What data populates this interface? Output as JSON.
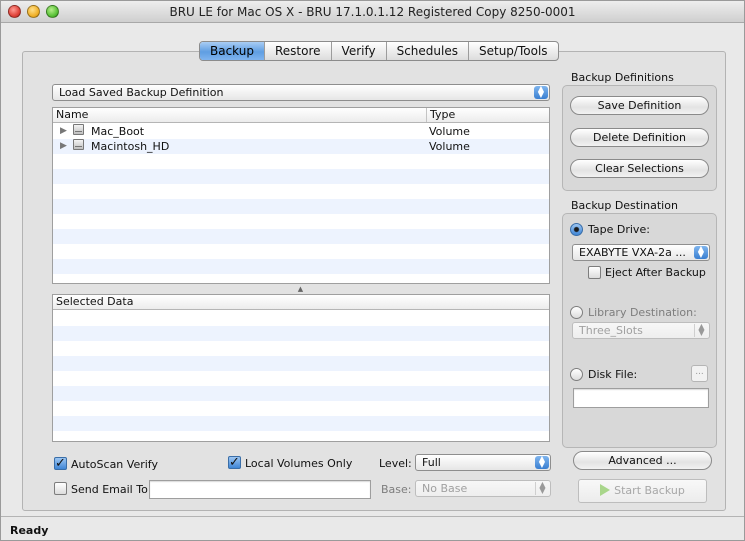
{
  "window": {
    "title": "BRU LE for Mac OS X - BRU 17.1.0.1.12 Registered Copy 8250-0001"
  },
  "tabs": [
    {
      "label": "Backup",
      "active": true
    },
    {
      "label": "Restore",
      "active": false
    },
    {
      "label": "Verify",
      "active": false
    },
    {
      "label": "Schedules",
      "active": false
    },
    {
      "label": "Setup/Tools",
      "active": false
    }
  ],
  "definition_popup": {
    "value": "Load Saved Backup Definition"
  },
  "source_table": {
    "headers": {
      "name": "Name",
      "type": "Type"
    },
    "rows": [
      {
        "name": "Mac_Boot",
        "type": "Volume"
      },
      {
        "name": "Macintosh_HD",
        "type": "Volume"
      }
    ]
  },
  "selected_table": {
    "header": "Selected Data"
  },
  "backup_definitions": {
    "title": "Backup Definitions",
    "save_label": "Save Definition",
    "delete_label": "Delete Definition",
    "clear_label": "Clear Selections"
  },
  "backup_destination": {
    "title": "Backup Destination",
    "tape_drive_label": "Tape Drive:",
    "tape_drive_selected": true,
    "tape_drive_value": "EXABYTE VXA-2a ...",
    "eject_label": "Eject After Backup",
    "eject_checked": false,
    "library_label": "Library Destination:",
    "library_value": "Three_Slots",
    "disk_file_label": "Disk File:",
    "disk_file_value": "",
    "browse_label": "..."
  },
  "options": {
    "autoscan_label": "AutoScan Verify",
    "autoscan_checked": true,
    "local_volumes_label": "Local Volumes Only",
    "local_volumes_checked": true,
    "send_email_label": "Send Email To:",
    "send_email_checked": false,
    "email_value": "",
    "level_label": "Level:",
    "level_value": "Full",
    "base_label": "Base:",
    "base_value": "No Base"
  },
  "actions": {
    "advanced_label": "Advanced ...",
    "start_label": "Start Backup"
  },
  "status": {
    "text": "Ready"
  }
}
